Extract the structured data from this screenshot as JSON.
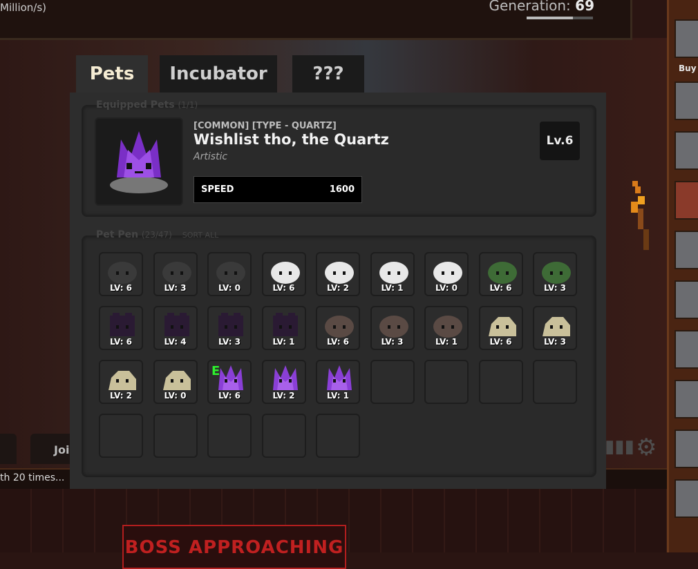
{
  "topbar": {
    "rate_text": "Million/s)",
    "generation_label": "Generation:",
    "generation_value": "69",
    "generation_progress": 0.7
  },
  "tabs": [
    {
      "label": "Pets",
      "active": true
    },
    {
      "label": "Incubator",
      "active": false
    },
    {
      "label": "???",
      "active": false
    }
  ],
  "equipped": {
    "title": "Equipped Pets",
    "count": "(1/1)",
    "meta": "[COMMON] [TYPE - QUARTZ]",
    "name": "Wishlist tho, the Quartz",
    "personality": "Artistic",
    "stat_label": "SPEED",
    "stat_value": "1600",
    "level": "Lv.6"
  },
  "pen": {
    "title": "Pet Pen",
    "count": "(23/47)",
    "sort_label": "SORT ALL",
    "pets": [
      {
        "type": "coal",
        "level": "LV: 6",
        "equipped": false
      },
      {
        "type": "coal",
        "level": "LV: 3",
        "equipped": false
      },
      {
        "type": "coal",
        "level": "LV: 0",
        "equipped": false
      },
      {
        "type": "white",
        "level": "LV: 6",
        "equipped": false
      },
      {
        "type": "white",
        "level": "LV: 2",
        "equipped": false
      },
      {
        "type": "white",
        "level": "LV: 1",
        "equipped": false
      },
      {
        "type": "white",
        "level": "LV: 0",
        "equipped": false
      },
      {
        "type": "moss",
        "level": "LV: 6",
        "equipped": false
      },
      {
        "type": "moss",
        "level": "LV: 3",
        "equipped": false
      },
      {
        "type": "obsidian",
        "level": "LV: 6",
        "equipped": false
      },
      {
        "type": "obsidian",
        "level": "LV: 4",
        "equipped": false
      },
      {
        "type": "obsidian",
        "level": "LV: 3",
        "equipped": false
      },
      {
        "type": "obsidian",
        "level": "LV: 1",
        "equipped": false
      },
      {
        "type": "mud",
        "level": "LV: 6",
        "equipped": false
      },
      {
        "type": "mud",
        "level": "LV: 3",
        "equipped": false
      },
      {
        "type": "mud",
        "level": "LV: 1",
        "equipped": false
      },
      {
        "type": "sand",
        "level": "LV: 6",
        "equipped": false
      },
      {
        "type": "sand",
        "level": "LV: 3",
        "equipped": false
      },
      {
        "type": "sand",
        "level": "LV: 2",
        "equipped": false
      },
      {
        "type": "sand",
        "level": "LV: 0",
        "equipped": false
      },
      {
        "type": "quartz",
        "level": "LV: 6",
        "equipped": true
      },
      {
        "type": "quartz",
        "level": "LV: 2",
        "equipped": false
      },
      {
        "type": "quartz",
        "level": "LV: 1",
        "equipped": false
      }
    ],
    "equipped_marker": "E",
    "empty_slots": 9
  },
  "pet_colors": {
    "coal": "#3a3a3a",
    "white": "#e8e8e8",
    "moss": "#3e6b36",
    "obsidian": "#2a1a33",
    "mud": "#5a4a44",
    "sand": "#c9c09a",
    "quartz": "#8a3fd6"
  },
  "background": {
    "bottom_text": "th 20 times...",
    "join_tab": "Joi",
    "boss_banner": "BOSS APPROACHING",
    "buy_label": "Buy"
  }
}
